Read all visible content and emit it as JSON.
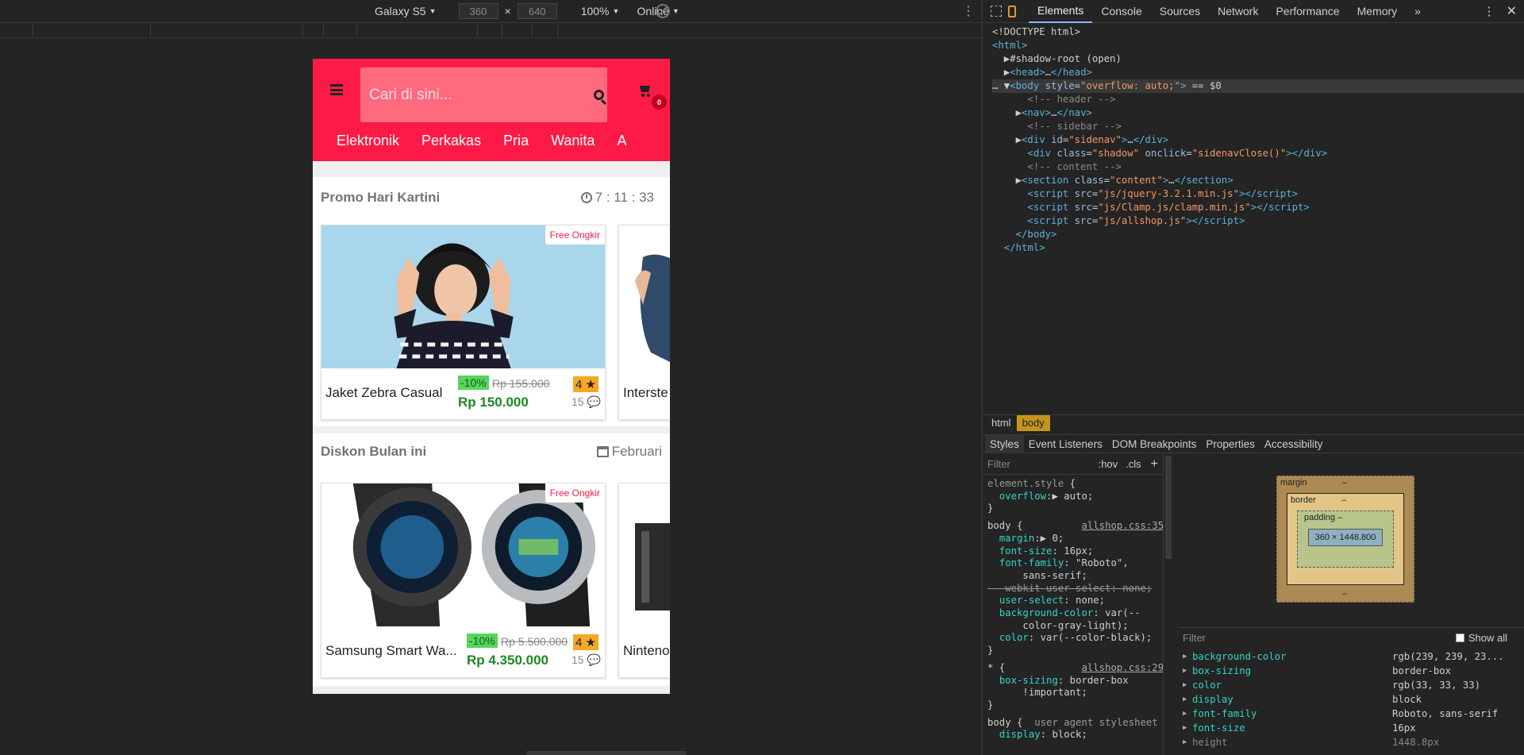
{
  "device_toolbar": {
    "device": "Galaxy S5",
    "width": "360",
    "times": "×",
    "height": "640",
    "zoom": "100%",
    "network": "Online"
  },
  "phone": {
    "search_placeholder": "Cari di sini...",
    "cart_count": "0",
    "categories": [
      "Elektronik",
      "Perkakas",
      "Pria",
      "Wanita",
      "A"
    ],
    "sections": [
      {
        "title": "Promo Hari Kartini",
        "right_text": "7 : 11 : 33",
        "right_icon": "clock-icon",
        "card": {
          "tag": "Free Ongkir",
          "name": "Jaket Zebra Casual",
          "discount": "-10%",
          "old_price": "Rp 155.000",
          "rating": "4",
          "new_price": "Rp 150.000",
          "reviews": "15"
        },
        "next_card_name": "Interste"
      },
      {
        "title": "Diskon Bulan ini",
        "right_text": "Februari",
        "right_icon": "calendar-icon",
        "card": {
          "tag": "Free Ongkir",
          "name": "Samsung Smart Wa...",
          "discount": "-10%",
          "old_price": "Rp 5.500.000",
          "rating": "4",
          "new_price": "Rp 4.350.000",
          "reviews": "15"
        },
        "next_card_name": "Ninteno"
      }
    ]
  },
  "devtools": {
    "tabs": [
      "Elements",
      "Console",
      "Sources",
      "Network",
      "Performance",
      "Memory"
    ],
    "more": "»",
    "breadcrumbs": [
      "html",
      "body"
    ],
    "subtabs": [
      "Styles",
      "Event Listeners",
      "DOM Breakpoints",
      "Properties",
      "Accessibility"
    ],
    "styles_filter": "Filter",
    "hov": ":hov",
    "cls": ".cls",
    "computed_filter": "Filter",
    "show_all": "Show all",
    "box_model": {
      "margin": "margin",
      "border": "border",
      "padding": "padding",
      "content": "360 × 1448.800",
      "dash": "–"
    },
    "computed": [
      {
        "k": "background-color",
        "v": "rgb(239, 239, 23..."
      },
      {
        "k": "box-sizing",
        "v": "border-box"
      },
      {
        "k": "color",
        "v": "rgb(33, 33, 33)"
      },
      {
        "k": "display",
        "v": "block"
      },
      {
        "k": "font-family",
        "v": "Roboto, sans-serif"
      },
      {
        "k": "font-size",
        "v": "16px"
      },
      {
        "k": "height",
        "v": "1448.8px"
      }
    ]
  },
  "colors": {
    "brand": "#fe1a47",
    "devtools_bg": "#242424",
    "selected_crumb": "#c4951c"
  }
}
